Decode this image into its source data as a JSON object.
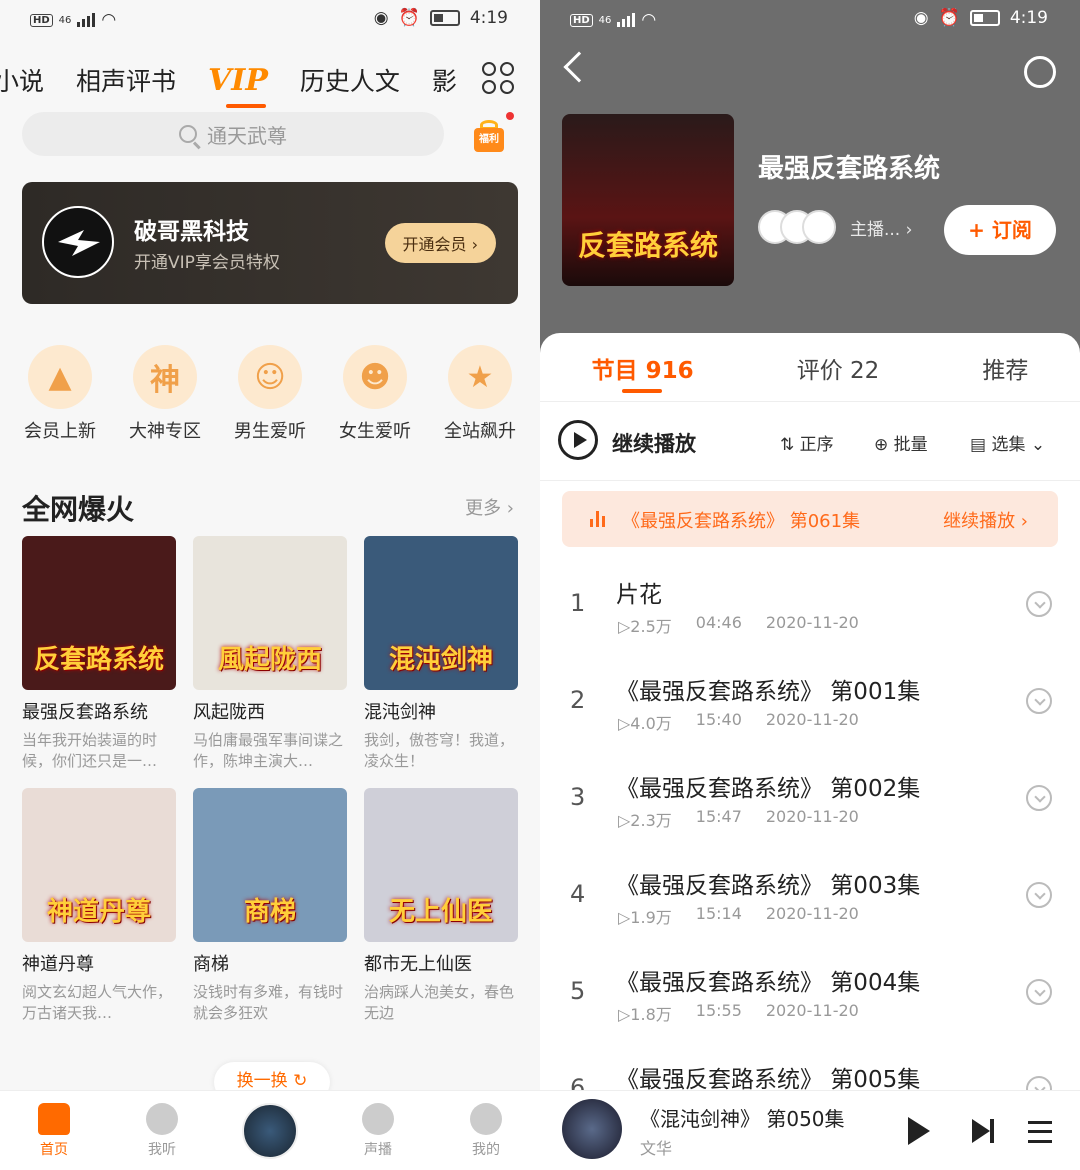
{
  "status": {
    "time": "4:19",
    "network": "46"
  },
  "left": {
    "category_tabs": [
      "小说",
      "相声评书",
      "VIP",
      "历史人文",
      "影"
    ],
    "search_placeholder": "通天武尊",
    "gift_label": "福利",
    "vip_card": {
      "name": "破哥黑科技",
      "subtitle": "开通VIP享会员特权",
      "button": "开通会员 ›"
    },
    "categories": [
      {
        "label": "会员上新",
        "icon": "rocket-icon",
        "glyph": "▲"
      },
      {
        "label": "大神专区",
        "icon": "god-icon",
        "glyph": "神"
      },
      {
        "label": "男生爱听",
        "icon": "boy-icon",
        "glyph": "☺"
      },
      {
        "label": "女生爱听",
        "icon": "girl-icon",
        "glyph": "☻"
      },
      {
        "label": "全站飙升",
        "icon": "rising-icon",
        "glyph": "★"
      }
    ],
    "section": {
      "title": "全网爆火",
      "more": "更多 ›"
    },
    "books": [
      {
        "title": "最强反套路系统",
        "desc": "当年我开始装逼的时候，你们还只是一…",
        "cover_text": "反套路系统",
        "bg": "#4a1a1a"
      },
      {
        "title": "风起陇西",
        "desc": "马伯庸最强军事间谍之作，陈坤主演大…",
        "cover_text": "風起陇西",
        "bg": "#e8e4dc"
      },
      {
        "title": "混沌剑神",
        "desc": "我剑，傲苍穹！我道，凌众生！",
        "cover_text": "混沌剑神",
        "bg": "#3a5a7a"
      },
      {
        "title": "神道丹尊",
        "desc": "阅文玄幻超人气大作，万古诸天我…",
        "cover_text": "神道丹尊",
        "bg": "#e9dcd6"
      },
      {
        "title": "商梯",
        "desc": "没钱时有多难，有钱时就会多狂欢",
        "cover_text": "商梯",
        "bg": "#7a9ab8"
      },
      {
        "title": "都市无上仙医",
        "desc": "治病踩人泡美女，春色无边",
        "cover_text": "无上仙医",
        "bg": "#cfcfd8"
      }
    ],
    "swap_label": "换一换 ↻",
    "tabbar": [
      {
        "label": "首页",
        "active": true
      },
      {
        "label": "我听",
        "active": false
      },
      {
        "label": "",
        "active": false
      },
      {
        "label": "声播",
        "active": false
      },
      {
        "label": "我的",
        "active": false
      }
    ]
  },
  "right": {
    "album_title": "最强反套路系统",
    "cover_text": "反套路系统",
    "hosts_label": "主播... ›",
    "subscribe": "+ 订阅",
    "tabs": [
      "节目 916",
      "评价 22",
      "推荐"
    ],
    "controls": {
      "continue": "继续播放",
      "order": "正序",
      "batch": "批量",
      "select": "选集"
    },
    "resume": {
      "text": "《最强反套路系统》 第061集",
      "action": "继续播放 ›"
    },
    "episodes": [
      {
        "num": "1",
        "title": "片花",
        "plays": "▷2.5万",
        "duration": "04:46",
        "date": "2020-11-20"
      },
      {
        "num": "2",
        "title": "《最强反套路系统》 第001集",
        "plays": "▷4.0万",
        "duration": "15:40",
        "date": "2020-11-20"
      },
      {
        "num": "3",
        "title": "《最强反套路系统》 第002集",
        "plays": "▷2.3万",
        "duration": "15:47",
        "date": "2020-11-20"
      },
      {
        "num": "4",
        "title": "《最强反套路系统》 第003集",
        "plays": "▷1.9万",
        "duration": "15:14",
        "date": "2020-11-20"
      },
      {
        "num": "5",
        "title": "《最强反套路系统》 第004集",
        "plays": "▷1.8万",
        "duration": "15:55",
        "date": "2020-11-20"
      },
      {
        "num": "6",
        "title": "《最强反套路系统》 第005集",
        "plays": "",
        "duration": "",
        "date": ""
      }
    ],
    "player": {
      "title": "《混沌剑神》 第050集",
      "subtitle": "文华"
    }
  }
}
